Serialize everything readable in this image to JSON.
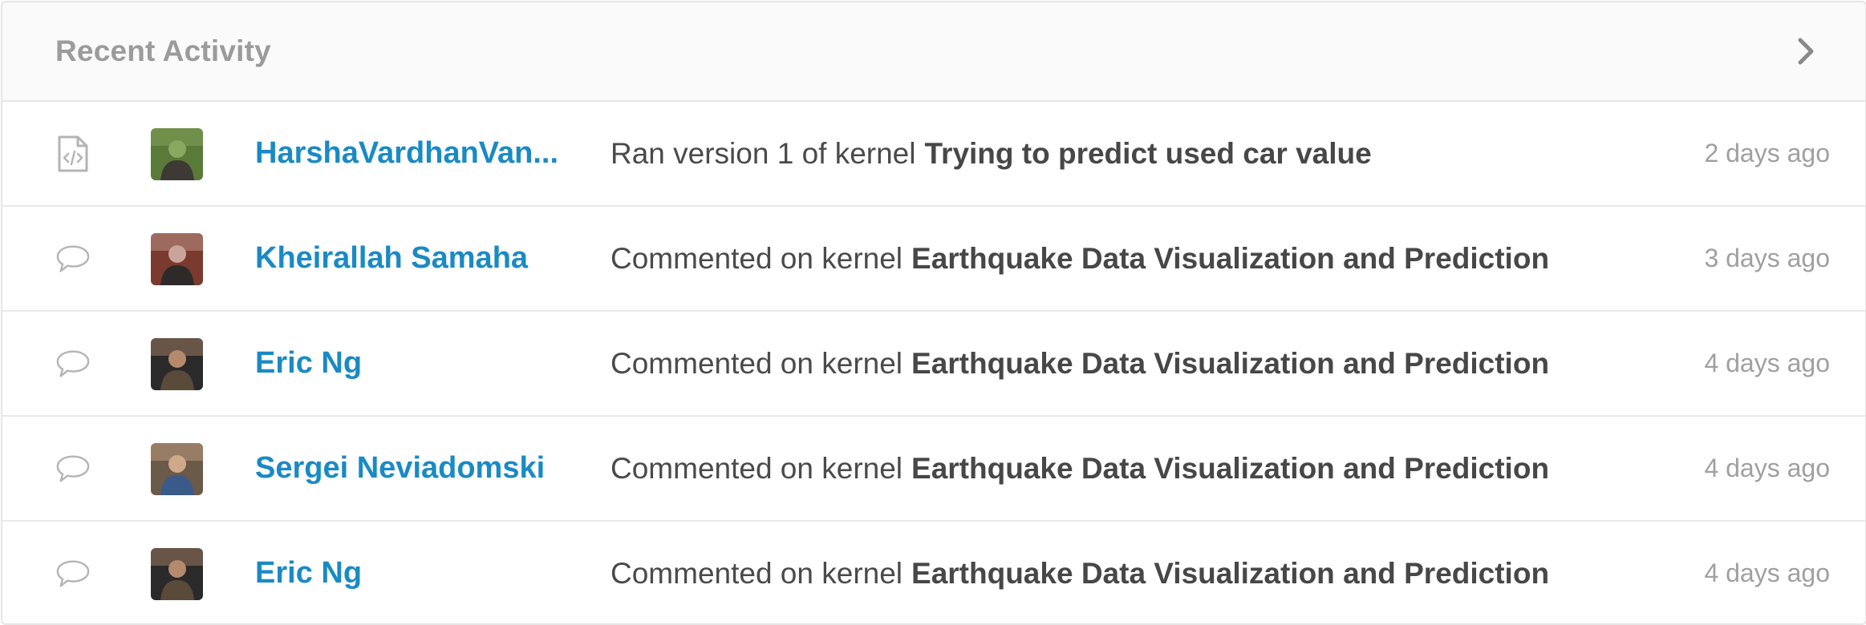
{
  "header": {
    "title": "Recent Activity",
    "chevron_icon": "chevron-right-icon"
  },
  "rows": [
    {
      "type_icon": "code-file-icon",
      "avatar_colors": [
        "#5a7a3a",
        "#8aa860",
        "#3d3a35"
      ],
      "user": "HarshaVardhanVan...",
      "verb": "Ran version 1 of kernel",
      "kernel": "Trying to predict used car value",
      "time": "2 days ago"
    },
    {
      "type_icon": "comment-icon",
      "avatar_colors": [
        "#7a3a2e",
        "#c9a49a",
        "#2e2a2a"
      ],
      "user": "Kheirallah Samaha",
      "verb": "Commented on kernel",
      "kernel": "Earthquake Data Visualization and Prediction",
      "time": "3 days ago"
    },
    {
      "type_icon": "comment-icon",
      "avatar_colors": [
        "#2a2a2a",
        "#b58a6c",
        "#5a4a3a"
      ],
      "user": "Eric Ng",
      "verb": "Commented on kernel",
      "kernel": "Earthquake Data Visualization and Prediction",
      "time": "4 days ago"
    },
    {
      "type_icon": "comment-icon",
      "avatar_colors": [
        "#6a5a4a",
        "#d0a88a",
        "#3a5a8a"
      ],
      "user": "Sergei Neviadomski",
      "verb": "Commented on kernel",
      "kernel": "Earthquake Data Visualization and Prediction",
      "time": "4 days ago"
    },
    {
      "type_icon": "comment-icon",
      "avatar_colors": [
        "#2a2a2a",
        "#b58a6c",
        "#5a4a3a"
      ],
      "user": "Eric Ng",
      "verb": "Commented on kernel",
      "kernel": "Earthquake Data Visualization and Prediction",
      "time": "4 days ago"
    }
  ],
  "colors": {
    "user_link": "#1a8ac4",
    "text": "#4a4a4a",
    "muted": "#9b9b9b",
    "border": "#e6e6e6"
  }
}
